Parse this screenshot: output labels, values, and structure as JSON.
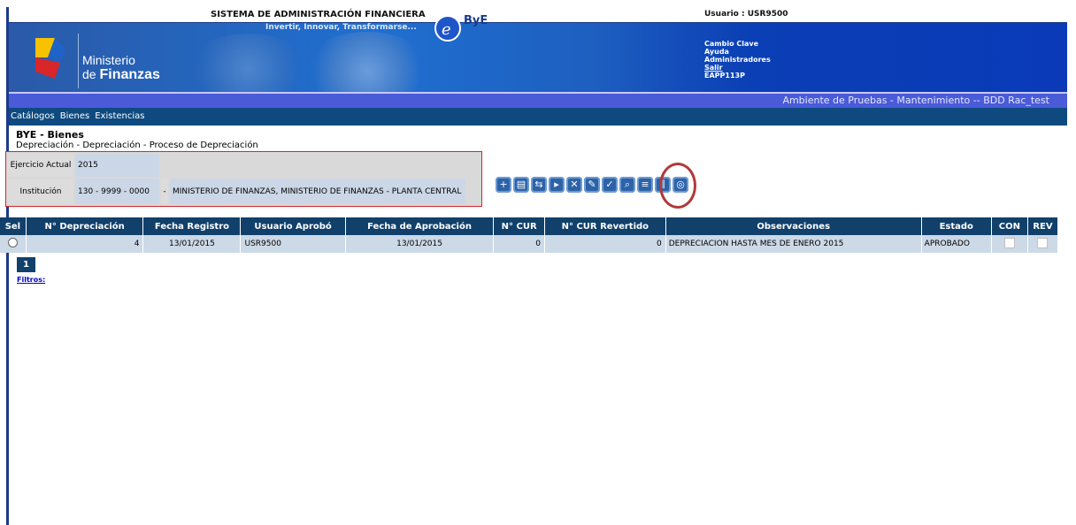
{
  "header": {
    "system_title": "SISTEMA DE ADMINISTRACIÓN FINANCIERA",
    "bye_logo": "ByE",
    "slogan": "Invertir, Innovar, Transformarse...",
    "user_label": "Usuario : USR9500",
    "ministerio_line1": "Ministerio",
    "ministerio_line2": "de",
    "ministerio_line3": "Finanzas",
    "right_menu": [
      "Cambio Clave",
      "Ayuda",
      "Administradores",
      "Salir",
      "EAPP113P"
    ]
  },
  "env_bar": "Ambiente de Pruebas - Mantenimiento -- BDD Rac_test",
  "menu": [
    "Catálogos",
    "Bienes",
    "Existencias"
  ],
  "page": {
    "title": "BYE - Bienes",
    "breadcrumb": "Depreciación - Depreciación - Proceso de Depreciación"
  },
  "info": {
    "ejercicio_label": "Ejercicio Actual",
    "ejercicio_value": "2015",
    "institucion_label": "Institución",
    "institucion_code": "130 - 9999 - 0000",
    "institucion_sep": "-",
    "institucion_name": "MINISTERIO DE FINANZAS, MINISTERIO DE FINANZAS - PLANTA CENTRAL"
  },
  "toolbar_icons": [
    "new-doc-icon",
    "save-doc-icon",
    "transfer-icon",
    "next-doc-icon",
    "delete-doc-icon",
    "edit-doc-icon",
    "approve-doc-icon",
    "search-doc-icon",
    "print-icon",
    "columns-icon",
    "query-icon"
  ],
  "table": {
    "headers": [
      "Sel",
      "N° Depreciación",
      "Fecha Registro",
      "Usuario Aprobó",
      "Fecha de Aprobación",
      "N° CUR",
      "N° CUR Revertido",
      "Observaciones",
      "Estado",
      "CON",
      "REV"
    ],
    "rows": [
      {
        "num": "4",
        "fecha_registro": "13/01/2015",
        "usuario": "USR9500",
        "fecha_aprobacion": "13/01/2015",
        "cur": "0",
        "cur_revertido": "0",
        "observaciones": "DEPRECIACION HASTA MES DE ENERO 2015",
        "estado": "APROBADO"
      }
    ]
  },
  "pager": {
    "current": "1"
  },
  "filtros": "Filtros:"
}
